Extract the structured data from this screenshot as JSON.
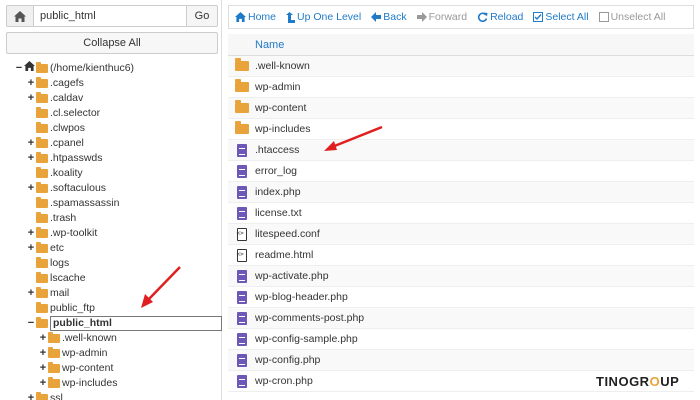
{
  "left_panel": {
    "path_value": "public_html",
    "go_label": "Go",
    "collapse_label": "Collapse All",
    "tree": [
      {
        "label": "(/home/kienthuc6)",
        "toggle": "−",
        "indent": 0,
        "icon": "home-icon"
      },
      {
        "label": ".cagefs",
        "toggle": "+",
        "indent": 1
      },
      {
        "label": ".caldav",
        "toggle": "+",
        "indent": 1
      },
      {
        "label": ".cl.selector",
        "toggle": "",
        "indent": 1
      },
      {
        "label": ".clwpos",
        "toggle": "",
        "indent": 1
      },
      {
        "label": ".cpanel",
        "toggle": "+",
        "indent": 1
      },
      {
        "label": ".htpasswds",
        "toggle": "+",
        "indent": 1
      },
      {
        "label": ".koality",
        "toggle": "",
        "indent": 1
      },
      {
        "label": ".softaculous",
        "toggle": "+",
        "indent": 1
      },
      {
        "label": ".spamassassin",
        "toggle": "",
        "indent": 1
      },
      {
        "label": ".trash",
        "toggle": "",
        "indent": 1
      },
      {
        "label": ".wp-toolkit",
        "toggle": "+",
        "indent": 1
      },
      {
        "label": "etc",
        "toggle": "+",
        "indent": 1
      },
      {
        "label": "logs",
        "toggle": "",
        "indent": 1
      },
      {
        "label": "lscache",
        "toggle": "",
        "indent": 1
      },
      {
        "label": "mail",
        "toggle": "+",
        "indent": 1
      },
      {
        "label": "public_ftp",
        "toggle": "",
        "indent": 1
      },
      {
        "label": "public_html",
        "toggle": "−",
        "indent": 1,
        "selected": true
      },
      {
        "label": ".well-known",
        "toggle": "+",
        "indent": 2
      },
      {
        "label": "wp-admin",
        "toggle": "+",
        "indent": 2
      },
      {
        "label": "wp-content",
        "toggle": "+",
        "indent": 2
      },
      {
        "label": "wp-includes",
        "toggle": "+",
        "indent": 2
      },
      {
        "label": "ssl",
        "toggle": "+",
        "indent": 1
      }
    ]
  },
  "toolbar": {
    "home": "Home",
    "up": "Up One Level",
    "back": "Back",
    "forward": "Forward",
    "reload": "Reload",
    "select_all": "Select All",
    "unselect_all": "Unselect All"
  },
  "file_list": {
    "column_name": "Name",
    "files": [
      {
        "name": ".well-known",
        "type": "folder"
      },
      {
        "name": "wp-admin",
        "type": "folder"
      },
      {
        "name": "wp-content",
        "type": "folder"
      },
      {
        "name": "wp-includes",
        "type": "folder"
      },
      {
        "name": ".htaccess",
        "type": "file"
      },
      {
        "name": "error_log",
        "type": "file"
      },
      {
        "name": "index.php",
        "type": "file"
      },
      {
        "name": "license.txt",
        "type": "file"
      },
      {
        "name": "litespeed.conf",
        "type": "code"
      },
      {
        "name": "readme.html",
        "type": "code"
      },
      {
        "name": "wp-activate.php",
        "type": "file"
      },
      {
        "name": "wp-blog-header.php",
        "type": "file"
      },
      {
        "name": "wp-comments-post.php",
        "type": "file"
      },
      {
        "name": "wp-config-sample.php",
        "type": "file"
      },
      {
        "name": "wp-config.php",
        "type": "file"
      },
      {
        "name": "wp-cron.php",
        "type": "file"
      }
    ]
  },
  "colors": {
    "link": "#1f7ac8",
    "folder": "#e8a33a",
    "file": "#6e58b7",
    "arrow": "#e02020"
  },
  "watermark": {
    "part1": "TINO",
    "part2": "GR",
    "part3": "O",
    "part4": "UP"
  }
}
